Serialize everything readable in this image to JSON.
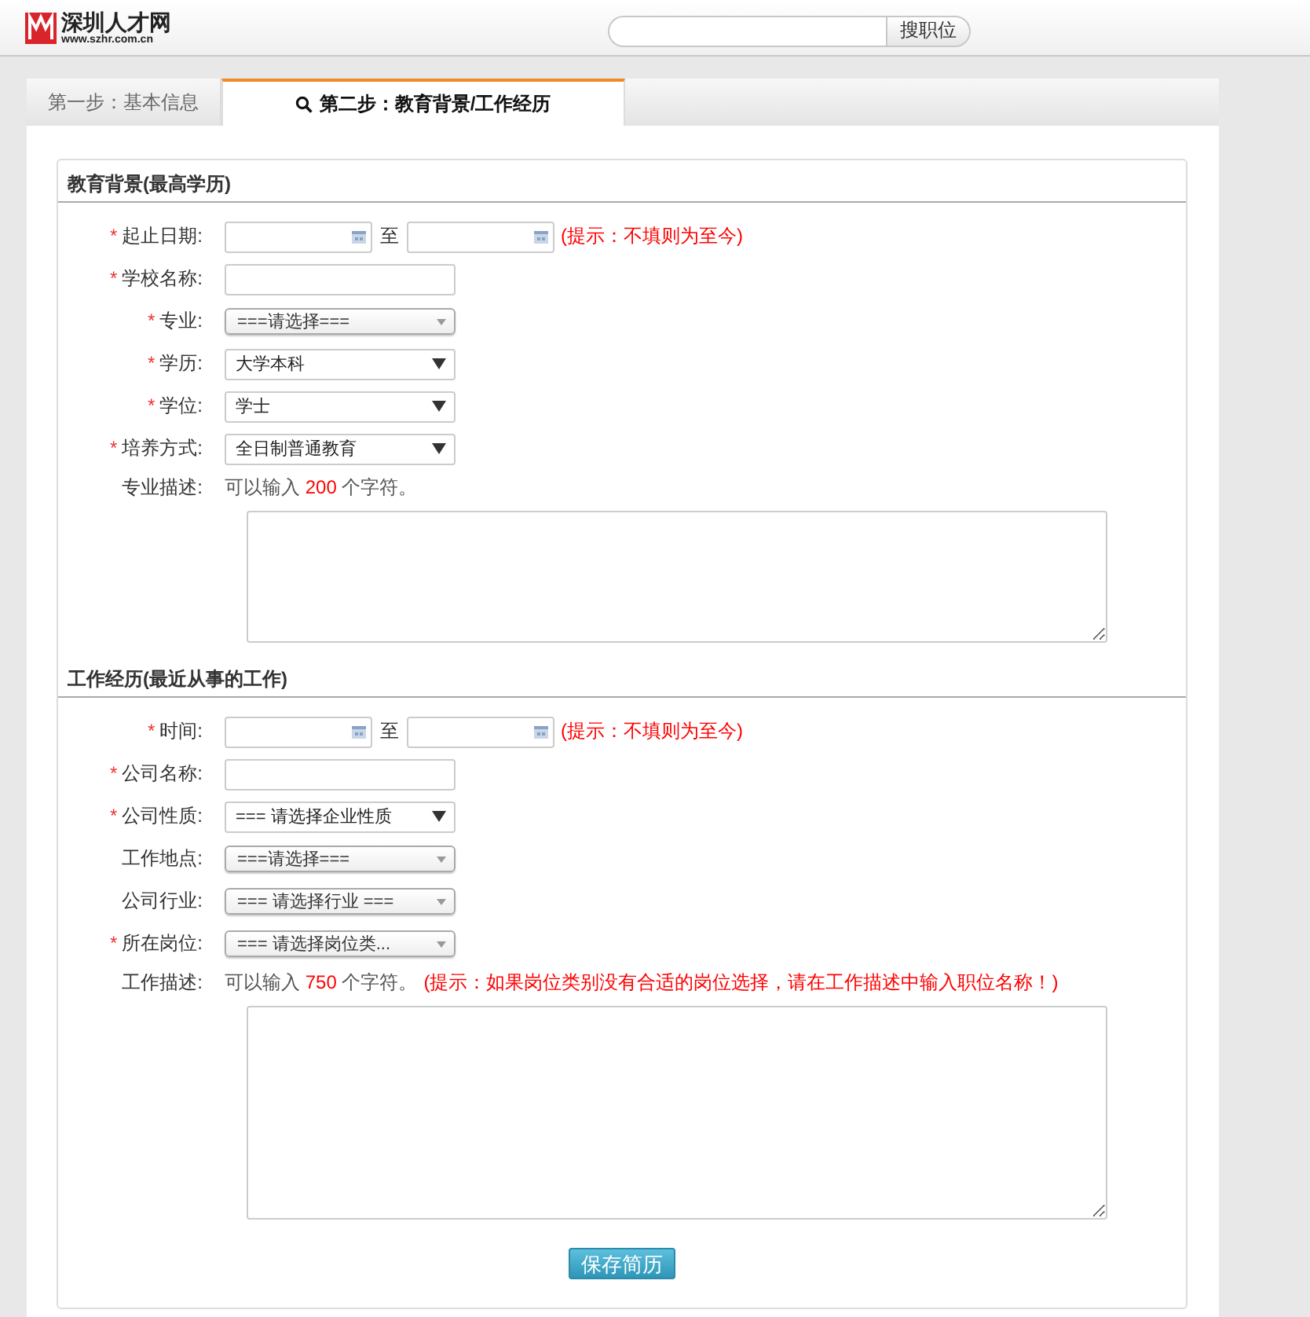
{
  "header": {
    "logo_name": "深圳人才网",
    "logo_url": "www.szhr.com.cn",
    "search": {
      "button": "搜职位"
    }
  },
  "tabs": [
    {
      "label": "第一步：基本信息",
      "selected": false,
      "icon": false
    },
    {
      "label": "第二步：教育背景/工作经历",
      "selected": true,
      "icon": true
    }
  ],
  "sections": [
    {
      "title": "教育背景(最高学历)",
      "rows": [
        {
          "kind": "daterange",
          "label": "起止日期:",
          "required_mark": "*",
          "separator": "至",
          "hint": "(提示：不填则为至今)"
        },
        {
          "kind": "text",
          "label": "学校名称:",
          "required_mark": "*"
        },
        {
          "kind": "combo",
          "label": "专业:",
          "required_mark": "*",
          "value": "===请选择==="
        },
        {
          "kind": "select",
          "label": "学历:",
          "required_mark": "*",
          "value": "大学本科"
        },
        {
          "kind": "select",
          "label": "学位:",
          "required_mark": "*",
          "value": "学士"
        },
        {
          "kind": "select",
          "label": "培养方式:",
          "required_mark": "*",
          "value": "全日制普通教育"
        },
        {
          "kind": "textarea",
          "label": "专业描述:",
          "note_before": "可以输入",
          "count": "200",
          "note_after": "个字符。"
        }
      ]
    },
    {
      "title": "工作经历(最近从事的工作)",
      "rows": [
        {
          "kind": "daterange",
          "label": "时间:",
          "required_mark": "*",
          "separator": "至",
          "hint": "(提示：不填则为至今)"
        },
        {
          "kind": "text",
          "label": "公司名称:",
          "required_mark": "*"
        },
        {
          "kind": "select",
          "label": "公司性质:",
          "required_mark": "*",
          "value": "=== 请选择企业性质"
        },
        {
          "kind": "combo",
          "label": "工作地点:",
          "value": "===请选择==="
        },
        {
          "kind": "combo",
          "label": "公司行业:",
          "value": "=== 请选择行业 ==="
        },
        {
          "kind": "combo",
          "label": "所在岗位:",
          "required_mark": "*",
          "value": "=== 请选择岗位类..."
        },
        {
          "kind": "textarea",
          "label": "工作描述:",
          "note_before": "可以输入",
          "count": "750",
          "note_after": "个字符。",
          "hint": "(提示：如果岗位类别没有合适的岗位选择，请在工作描述中输入职位名称！)"
        }
      ]
    }
  ],
  "save_button": "保存简历"
}
